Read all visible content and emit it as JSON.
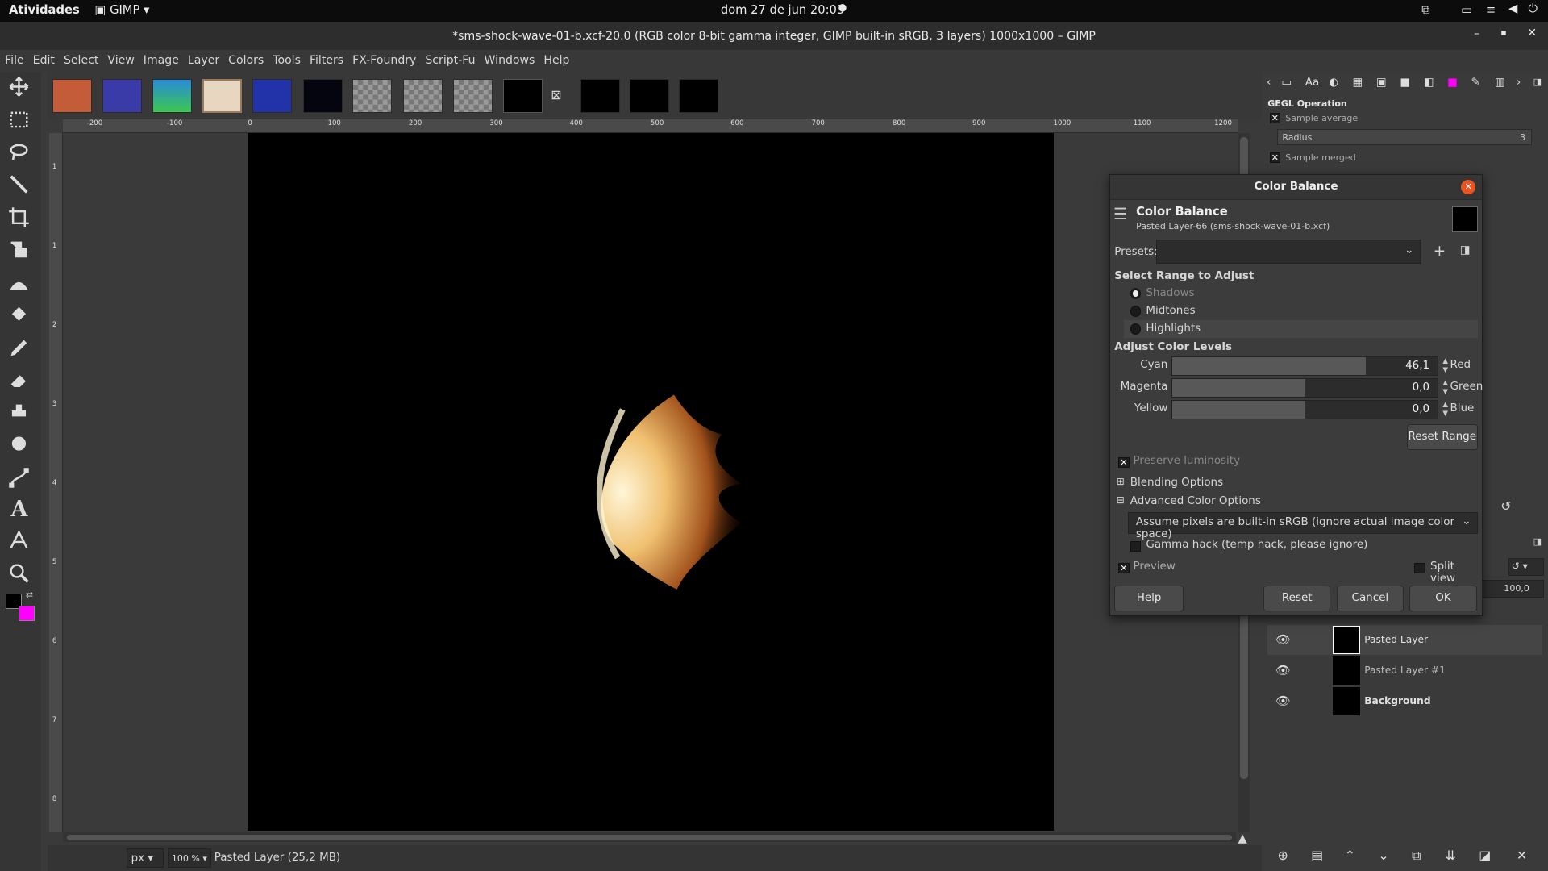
{
  "topbar": {
    "activities": "Atividades",
    "app": "GIMP",
    "datetime": "dom 27 de jun  20:03"
  },
  "window": {
    "title": "*sms-shock-wave-01-b.xcf-20.0 (RGB color 8-bit gamma integer, GIMP built-in sRGB, 3 layers) 1000x1000 – GIMP"
  },
  "menu": [
    "File",
    "Edit",
    "Select",
    "View",
    "Image",
    "Layer",
    "Colors",
    "Tools",
    "Filters",
    "FX-Foundry",
    "Script-Fu",
    "Windows",
    "Help"
  ],
  "ruler": {
    "h": [
      "-200",
      "-100",
      "0",
      "100",
      "200",
      "300",
      "400",
      "500",
      "600",
      "700",
      "800",
      "900",
      "1000",
      "1100",
      "1200"
    ],
    "v": [
      "1",
      "1",
      "2",
      "3",
      "4",
      "5",
      "6",
      "7",
      "8",
      "9"
    ]
  },
  "status": {
    "unit": "px",
    "zoom": "100 %",
    "layer_info": "Pasted Layer (25,2 MB)"
  },
  "gegl": {
    "title": "GEGL Operation",
    "sample_average": "Sample average",
    "radius_label": "Radius",
    "radius_value": "3",
    "sample_merged": "Sample merged"
  },
  "dialog": {
    "title": "Color Balance",
    "heading": "Color Balance",
    "subheading": "Pasted Layer-66 (sms-shock-wave-01-b.xcf)",
    "presets_label": "Presets:",
    "range_heading": "Select Range to Adjust",
    "ranges": [
      "Shadows",
      "Midtones",
      "Highlights"
    ],
    "levels_heading": "Adjust Color Levels",
    "sliders": [
      {
        "left": "Cyan",
        "right": "Red",
        "value": "46,1",
        "level": 0.73
      },
      {
        "left": "Magenta",
        "right": "Green",
        "value": "0,0",
        "level": 0.5
      },
      {
        "left": "Yellow",
        "right": "Blue",
        "value": "0,0",
        "level": 0.5
      }
    ],
    "reset_range": "Reset Range",
    "preserve_luminosity": "Preserve luminosity",
    "blending_options": "Blending Options",
    "advanced_options": "Advanced Color Options",
    "color_space": "Assume pixels are built-in sRGB (ignore actual image color space)",
    "gamma_hack": "Gamma hack (temp hack, please ignore)",
    "preview": "Preview",
    "split_view": "Split view",
    "buttons": {
      "help": "Help",
      "reset": "Reset",
      "cancel": "Cancel",
      "ok": "OK"
    }
  },
  "layers_panel": {
    "opacity": "100,0",
    "layers": [
      "Pasted Layer",
      "Pasted Layer #1",
      "Background"
    ]
  },
  "colors": {
    "fg": "#000000",
    "bg": "#ff00ff"
  }
}
